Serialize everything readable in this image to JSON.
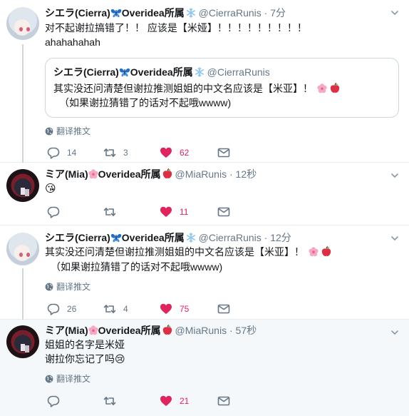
{
  "tweets": [
    {
      "name": "シエラ(Cierra)",
      "name_suffix": "Overidea所属",
      "handle": "@CierraRunis",
      "dot": "·",
      "time": "7分",
      "text_line1": "对不起谢拉搞错了！！ 应该是【米娅】！！！！！！！！！",
      "text_line2": "ahahahahah",
      "quote": {
        "name": "シエラ(Cierra)",
        "name_suffix": "Overidea所属",
        "handle": "@CierraRunis",
        "line1": "其实没还问清楚但谢拉推测姐姐的中文名应该是【米亚】！",
        "line2": "（如果谢拉猜错了的话对不起哦wwww)"
      },
      "translate": "翻译推文",
      "replies": "14",
      "retweets": "3",
      "likes": "62"
    },
    {
      "name": "ミア(Mia)",
      "name_suffix": "Overidea所属",
      "handle": "@MiaRunis",
      "dot": "·",
      "time": "12秒",
      "text_line1": "😘",
      "replies": "",
      "retweets": "",
      "likes": "11"
    },
    {
      "name": "シエラ(Cierra)",
      "name_suffix": "Overidea所属",
      "handle": "@CierraRunis",
      "dot": "·",
      "time": "12分",
      "text_line1": "其实没还问清楚但谢拉推测姐姐的中文名应该是【米亚】！",
      "text_line2": "（如果谢拉猜错了的话对不起哦wwww)",
      "translate": "翻译推文",
      "replies": "26",
      "retweets": "4",
      "likes": "75"
    },
    {
      "name": "ミア(Mia)",
      "name_suffix": "Overidea所属",
      "handle": "@MiaRunis",
      "dot": "·",
      "time": "57秒",
      "text_line1": "姐姐的名字是米娅",
      "text_line2": "谢拉你忘记了吗😢",
      "translate": "翻译推文",
      "replies": "",
      "retweets": "",
      "likes": "21"
    }
  ],
  "icons": {
    "butterfly": "butterfly-icon",
    "snowflake": "snowflake-icon",
    "flower": "cherry-blossom-icon",
    "apple": "red-apple-icon",
    "globe": "globe-icon",
    "reply": "reply-icon",
    "retweet": "retweet-icon",
    "like": "heart-icon",
    "dm": "direct-message-icon",
    "more": "chevron-down-icon"
  },
  "colors": {
    "like": "#e0245e",
    "muted": "#657786",
    "border": "#e6ecf0",
    "highlight_bg": "#f5f8fa",
    "butterfly": "#1d6fd0",
    "snowflake": "#8ec8f0"
  }
}
